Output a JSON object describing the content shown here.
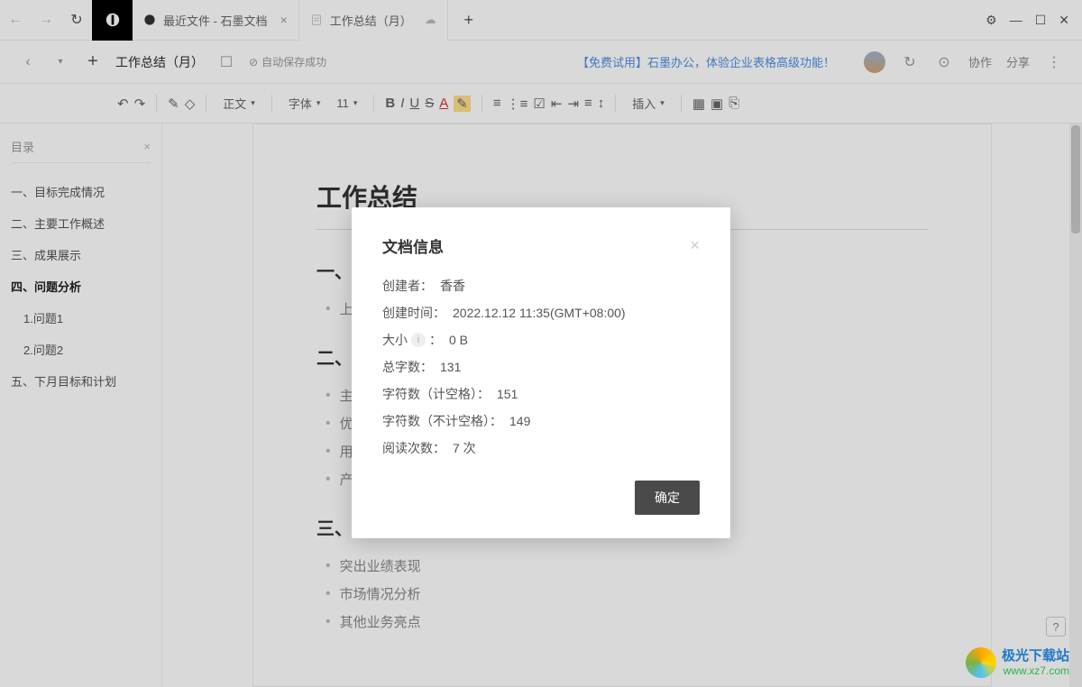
{
  "titlebar": {
    "tab1": "最近文件 - 石墨文档",
    "tab2": "工作总结（月）"
  },
  "header": {
    "docTitle": "工作总结（月）",
    "autosave": "自动保存成功",
    "promo": "【免费试用】石墨办公，体验企业表格高级功能！",
    "collab": "协作",
    "share": "分享"
  },
  "toolbar": {
    "normal": "正文",
    "font": "字体",
    "size": "11",
    "insert": "插入"
  },
  "sidebar": {
    "title": "目录",
    "items": [
      "一、目标完成情况",
      "二、主要工作概述",
      "三、成果展示",
      "四、问题分析",
      "1.问题1",
      "2.问题2",
      "五、下月目标和计划"
    ]
  },
  "doc": {
    "title": "工作总结",
    "h1": "一、目标完",
    "b1": "上月目标为X",
    "h2": "二、主要工",
    "b2a": "主要内容",
    "b2b": "优化方向",
    "b2c": "用户反馈",
    "b2d": "产品建议",
    "h3": "三、成果展示",
    "b3a": "突出业绩表现",
    "b3b": "市场情况分析",
    "b3c": "其他业务亮点"
  },
  "dialog": {
    "title": "文档信息",
    "rows": {
      "creator_l": "创建者：",
      "creator_v": "香香",
      "created_l": "创建时间：",
      "created_v": "2022.12.12 11:35(GMT+08:00)",
      "size_l": "大小",
      "size_v": "0 B",
      "words_l": "总字数：",
      "words_v": "131",
      "chars_sp_l": "字符数（计空格）：",
      "chars_sp_v": "151",
      "chars_nsp_l": "字符数（不计空格）：",
      "chars_nsp_v": "149",
      "reads_l": "阅读次数：",
      "reads_v": "7 次"
    },
    "confirm": "确定"
  },
  "watermark": {
    "cn": "极光下载站",
    "url": "www.xz7.com"
  }
}
